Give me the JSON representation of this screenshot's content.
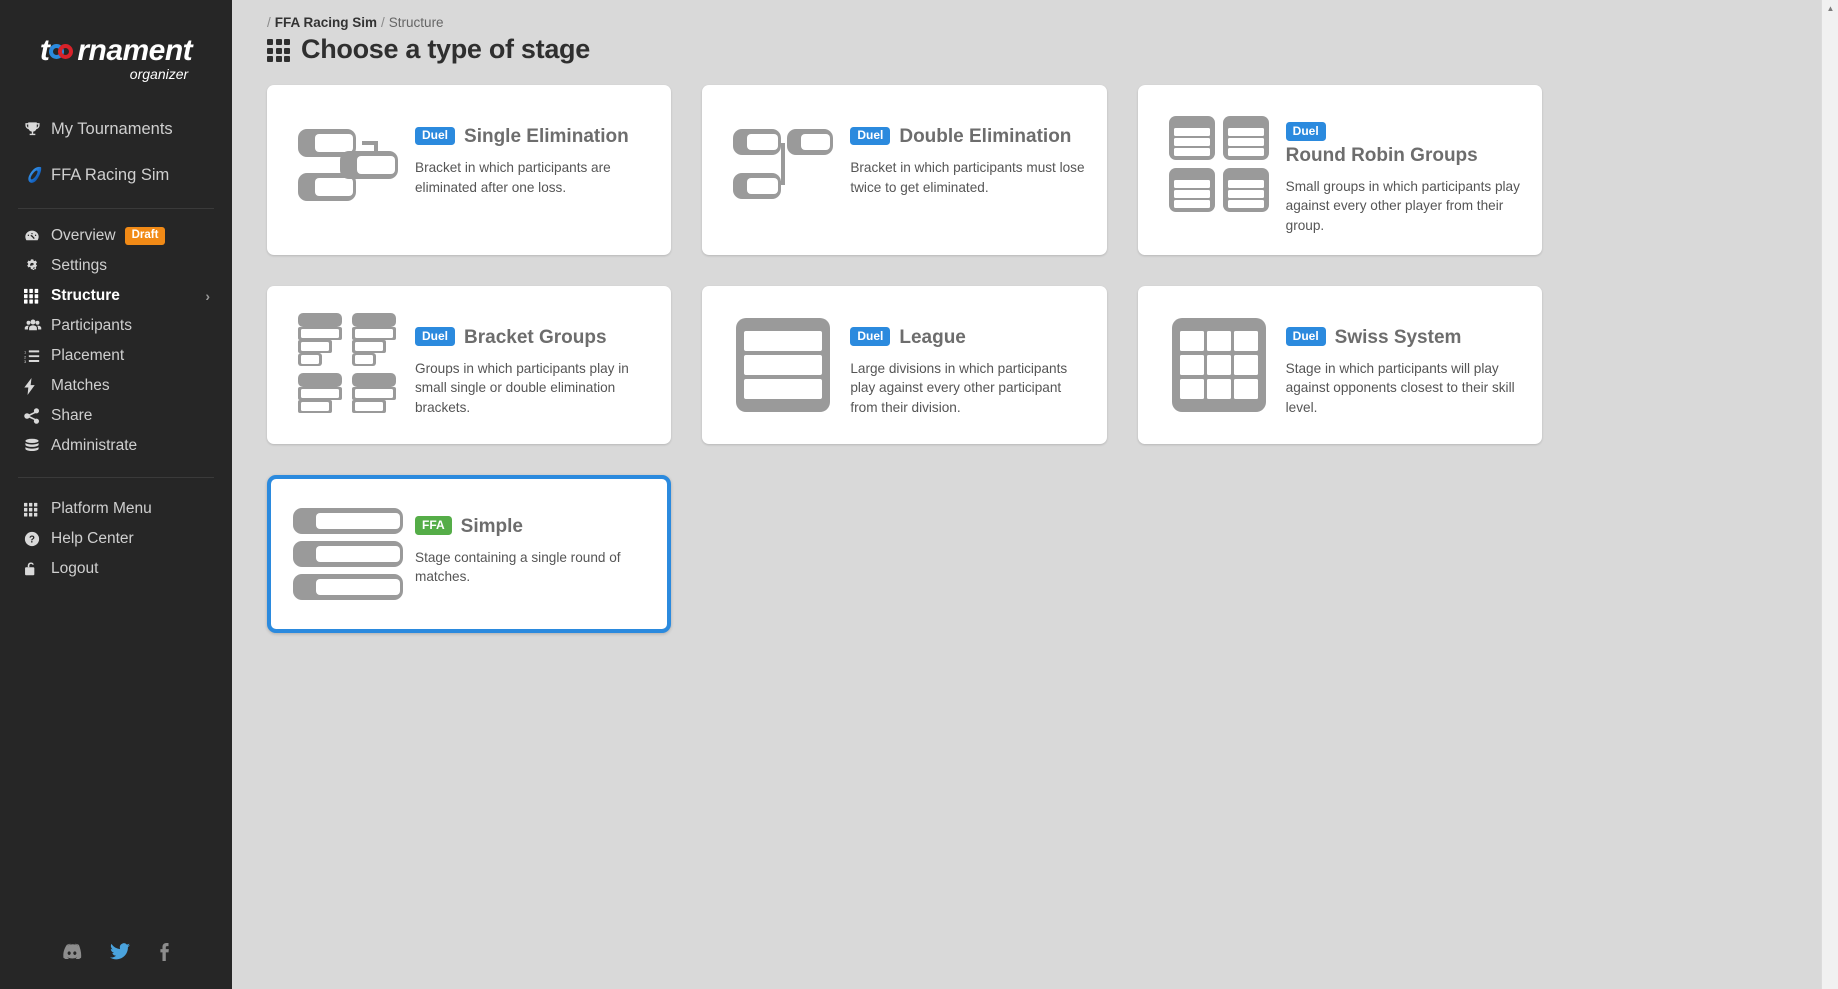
{
  "brand": {
    "logo_main": "t",
    "logo_main_rest": "rnament",
    "logo_sub": "organizer"
  },
  "sidebar": {
    "top_items": [
      {
        "label": "My Tournaments",
        "icon": "trophy-icon",
        "key": "my-tournaments"
      },
      {
        "label": "FFA Racing Sim",
        "icon": "racing-icon",
        "key": "ffa-racing-sim"
      }
    ],
    "items": [
      {
        "label": "Overview",
        "icon": "dashboard-icon",
        "key": "overview",
        "badge": "Draft"
      },
      {
        "label": "Settings",
        "icon": "gears-icon",
        "key": "settings"
      },
      {
        "label": "Structure",
        "icon": "grid-icon",
        "key": "structure",
        "active": true,
        "chevron": "›"
      },
      {
        "label": "Participants",
        "icon": "users-icon",
        "key": "participants"
      },
      {
        "label": "Placement",
        "icon": "ordered-list-icon",
        "key": "placement"
      },
      {
        "label": "Matches",
        "icon": "bolt-icon",
        "key": "matches"
      },
      {
        "label": "Share",
        "icon": "share-icon",
        "key": "share"
      },
      {
        "label": "Administrate",
        "icon": "database-icon",
        "key": "administrate"
      }
    ],
    "footer_items": [
      {
        "label": "Platform Menu",
        "icon": "apps-grid-icon",
        "key": "platform-menu"
      },
      {
        "label": "Help Center",
        "icon": "question-circle-icon",
        "key": "help-center"
      },
      {
        "label": "Logout",
        "icon": "unlock-icon",
        "key": "logout"
      }
    ],
    "socials": [
      {
        "name": "discord-icon"
      },
      {
        "name": "twitter-icon"
      },
      {
        "name": "facebook-icon"
      }
    ]
  },
  "breadcrumb": {
    "lead_sep": "/",
    "tournament": "FFA Racing Sim",
    "mid_sep": "/",
    "section": "Structure"
  },
  "header": {
    "title": "Choose a type of stage"
  },
  "colors": {
    "accent_blue": "#2b8ade",
    "ffa_green": "#55ad48",
    "draft_orange": "#f18a16",
    "sidebar_bg": "#262626",
    "page_bg": "#d9d9d9"
  },
  "stages": [
    {
      "key": "single-elimination",
      "tag": "Duel",
      "tag_type": "duel",
      "title": "Single Elimination",
      "description": "Bracket in which participants are eliminated after one loss.",
      "icon": "single-elimination-bracket-icon",
      "selected": false
    },
    {
      "key": "double-elimination",
      "tag": "Duel",
      "tag_type": "duel",
      "title": "Double Elimination",
      "description": "Bracket in which participants must lose twice to get eliminated.",
      "icon": "double-elimination-bracket-icon",
      "selected": false
    },
    {
      "key": "round-robin-groups",
      "tag": "Duel",
      "tag_type": "duel",
      "title": "Round Robin Groups",
      "description": "Small groups in which participants play against every other player from their group.",
      "icon": "round-robin-groups-icon",
      "selected": false
    },
    {
      "key": "bracket-groups",
      "tag": "Duel",
      "tag_type": "duel",
      "title": "Bracket Groups",
      "description": "Groups in which participants play in small single or double elimination brackets.",
      "icon": "bracket-groups-icon",
      "selected": false
    },
    {
      "key": "league",
      "tag": "Duel",
      "tag_type": "duel",
      "title": "League",
      "description": "Large divisions in which participants play against every other participant from their division.",
      "icon": "league-icon",
      "selected": false
    },
    {
      "key": "swiss-system",
      "tag": "Duel",
      "tag_type": "duel",
      "title": "Swiss System",
      "description": "Stage in which participants will play against opponents closest to their skill level.",
      "icon": "swiss-system-grid-icon",
      "selected": false
    },
    {
      "key": "simple",
      "tag": "FFA",
      "tag_type": "ffa",
      "title": "Simple",
      "description": "Stage containing a single round of matches.",
      "icon": "simple-rounds-icon",
      "selected": true
    }
  ]
}
